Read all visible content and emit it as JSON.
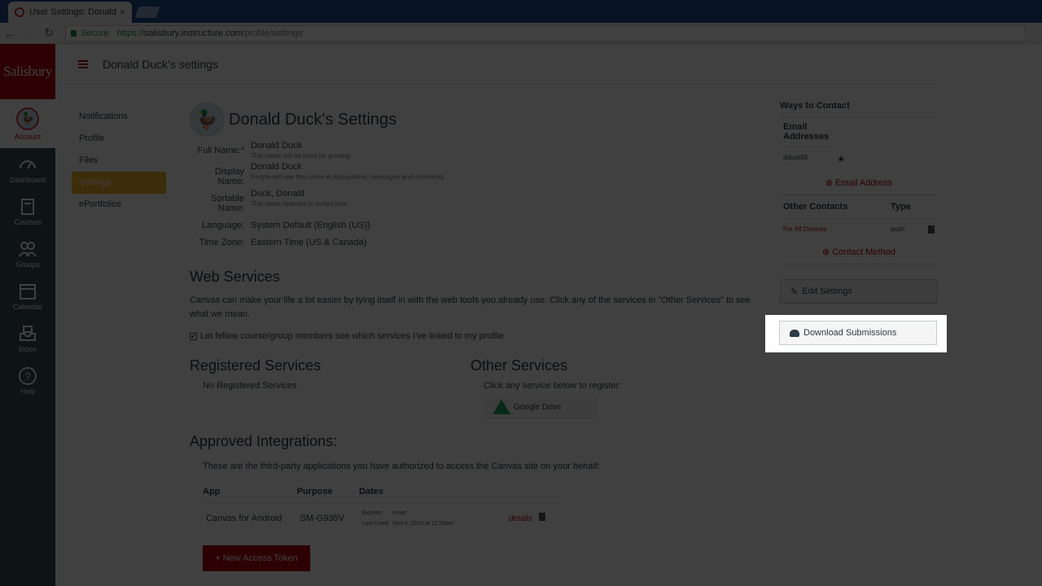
{
  "browser": {
    "tab_title": "User Settings: Donald D…",
    "tab_close": "×",
    "secure_label": "Secure",
    "url_scheme": "https://",
    "url_host": "salisbury.instructure.com",
    "url_path": "/profile/settings"
  },
  "globalnav": {
    "logo": "Salisbury",
    "items": [
      {
        "label": "Account",
        "icon": "avatar"
      },
      {
        "label": "Dashboard",
        "icon": "dashboard-icon"
      },
      {
        "label": "Courses",
        "icon": "courses-icon"
      },
      {
        "label": "Groups",
        "icon": "groups-icon"
      },
      {
        "label": "Calendar",
        "icon": "calendar-icon"
      },
      {
        "label": "Inbox",
        "icon": "inbox-icon"
      },
      {
        "label": "Help",
        "icon": "help-icon"
      }
    ]
  },
  "header": {
    "crumb": "Donald Duck's settings"
  },
  "leftnav": {
    "items": [
      "Notifications",
      "Profile",
      "Files",
      "Settings",
      "ePortfolios"
    ],
    "active": "Settings"
  },
  "profile": {
    "title": "Donald Duck's Settings",
    "full_name_label": "Full Name:*",
    "full_name": "Donald Duck",
    "full_name_hint": "This name will be used for grading.",
    "display_name_label": "Display Name:",
    "display_name": "Donald Duck",
    "display_name_hint": "People will see this name in discussions, messages and comments.",
    "sortable_name_label": "Sortable Name:",
    "sortable_name": "Duck, Donald",
    "sortable_name_hint": "This name appears in sorted lists.",
    "language_label": "Language:",
    "language": "System Default (English (US))",
    "timezone_label": "Time Zone:",
    "timezone": "Eastern Time (US & Canada)"
  },
  "web_services": {
    "heading": "Web Services",
    "description": "Canvas can make your life a lot easier by tying itself in with the web tools you already use. Click any of the services in \"Other Services\" to see what we mean.",
    "checkbox_label": "Let fellow course/group members see which services I've linked to my profile",
    "checkbox_mark": "✔",
    "registered_heading": "Registered Services",
    "registered_empty": "No Registered Services",
    "other_heading": "Other Services",
    "other_hint": "Click any service below to register:",
    "google_drive": "Google Drive"
  },
  "integrations": {
    "heading": "Approved Integrations:",
    "description": "These are the third-party applications you have authorized to access the Canvas site on your behalf:",
    "columns": [
      "App",
      "Purpose",
      "Dates"
    ],
    "row": {
      "app": "Canvas for Android",
      "purpose": "SM-G935V",
      "expires_label": "Expires:",
      "expires": "never",
      "last_used_label": "Last Used:",
      "last_used": "Nov 4, 2016 at 12:59am",
      "details": "details"
    },
    "new_token_button": "+ New Access Token"
  },
  "contact": {
    "heading": "Ways to Contact",
    "email_heading": "Email Addresses",
    "email": "dduck88",
    "add_email": "⊕ Email Address",
    "other_contacts": "Other Contacts",
    "type_col": "Type",
    "contact_name": "For All Devices",
    "contact_type": "push",
    "add_contact": "⊕ Contact Method",
    "edit_settings": "Edit Settings",
    "download_submissions": "Download Submissions"
  }
}
